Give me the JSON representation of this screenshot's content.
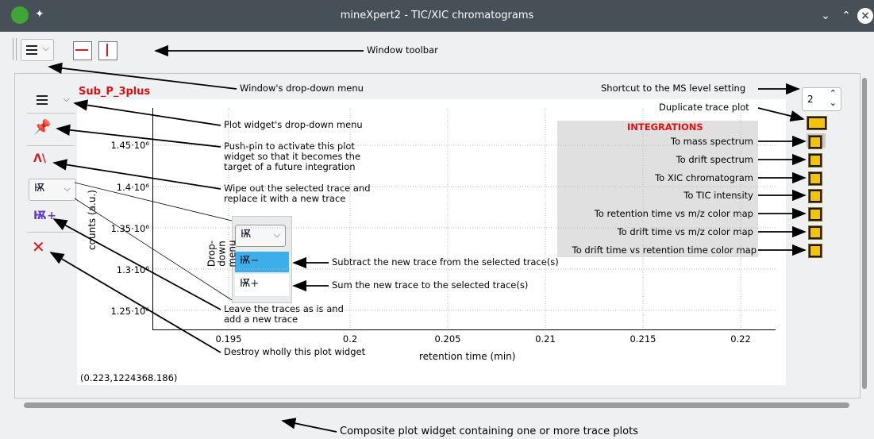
{
  "window": {
    "title": "mineXpert2 - TIC/XIC chromatograms",
    "controls": [
      "⌄",
      "⌃",
      "⊗"
    ]
  },
  "annotations": {
    "window_toolbar": "Window toolbar",
    "window_menu": "Window's drop-down menu",
    "plot_menu": "Plot widget's drop-down menu",
    "push_pin_1": "Push-pin to activate this plot",
    "push_pin_2": "widget so that it becomes the",
    "push_pin_3": "target of a future integration",
    "wipe_1": "Wipe out the selected trace and",
    "wipe_2": "replace it with a new trace",
    "subtract": "Subtract the new trace from the selected trace(s)",
    "sum": "Sum the new trace to the selected trace(s)",
    "leave_1": "Leave the traces as is and",
    "leave_2": "add a new trace",
    "destroy": "Destroy wholly this plot widget",
    "ms_level_shortcut": "Shortcut to the MS level setting",
    "duplicate": "Duplicate trace plot",
    "composite": "Composite plot widget containing one or more trace plots",
    "dropdown_menu_1": "Drop-down",
    "dropdown_menu_2": "menu"
  },
  "plot": {
    "title": "Sub_P_3plus",
    "ms_level": "2",
    "coords": "(0.223,1224368.186)",
    "xlabel": "retention time (min)",
    "ylabel": "counts (a.u.)",
    "y_ticks": [
      "1.45·10⁶",
      "1.4·10⁶",
      "1.35·10⁶",
      "1.3·10⁶",
      "1.25·10⁶"
    ],
    "x_ticks": [
      "0.195",
      "0.2",
      "0.205",
      "0.21",
      "0.215",
      "0.22"
    ]
  },
  "integrations": {
    "header": "INTEGRATIONS",
    "items": [
      "To mass spectrum",
      "To drift spectrum",
      "To XIC chromatogram",
      "To TIC intensity",
      "To retention time vs m/z color map",
      "To drift time vs m/z color map",
      "To drift time vs retention time color map"
    ]
  },
  "colors": {
    "accent_red": "#e01010",
    "titlebar": "#475057",
    "selection": "#3daee9"
  }
}
